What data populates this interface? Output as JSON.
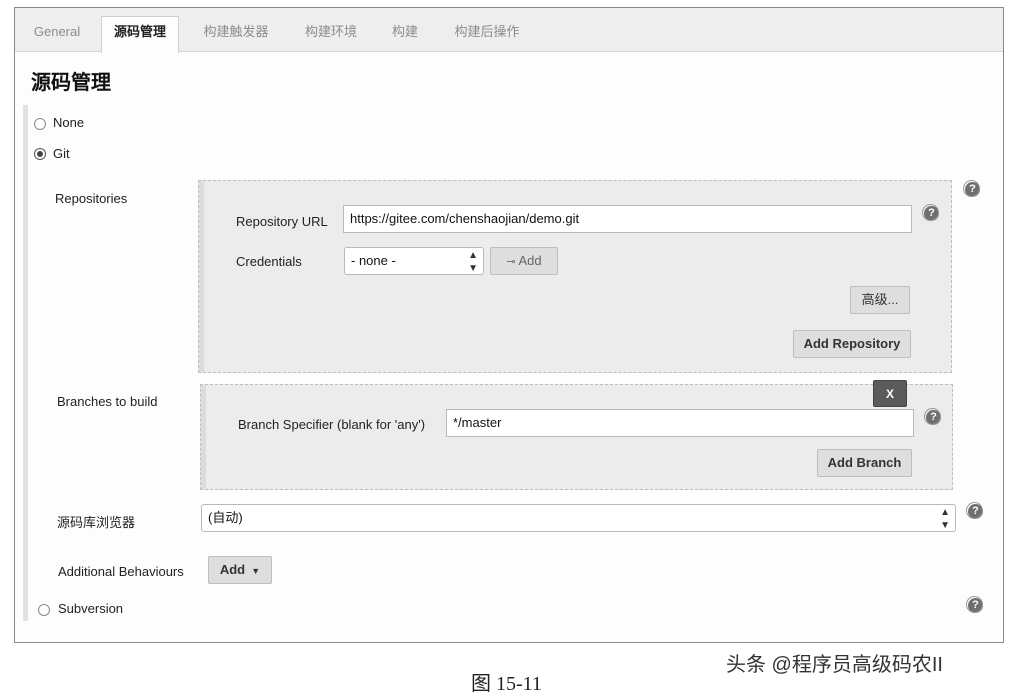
{
  "tabs": [
    {
      "label": "General"
    },
    {
      "label": "源码管理"
    },
    {
      "label": "构建触发器"
    },
    {
      "label": "构建环境"
    },
    {
      "label": "构建"
    },
    {
      "label": "构建后操作"
    }
  ],
  "section_title": "源码管理",
  "scm_options": {
    "none": "None",
    "git": "Git",
    "subversion": "Subversion",
    "selected": "Git"
  },
  "repositories": {
    "label": "Repositories",
    "url_label": "Repository URL",
    "url_value": "https://gitee.com/chenshaojian/demo.git",
    "credentials_label": "Credentials",
    "credentials_value": "- none -",
    "add_credentials_label": "Add",
    "advanced_label": "高级...",
    "add_repository_label": "Add Repository"
  },
  "branches": {
    "label": "Branches to build",
    "delete_label": "X",
    "specifier_label": "Branch Specifier (blank for 'any')",
    "specifier_value": "*/master",
    "add_branch_label": "Add Branch"
  },
  "browser": {
    "label": "源码库浏览器",
    "value": "(自动)"
  },
  "behaviours": {
    "label": "Additional Behaviours",
    "add_label": "Add"
  },
  "help_glyph": "?",
  "caption": "图 15-11",
  "watermark": "头条 @程序员高级码农II"
}
